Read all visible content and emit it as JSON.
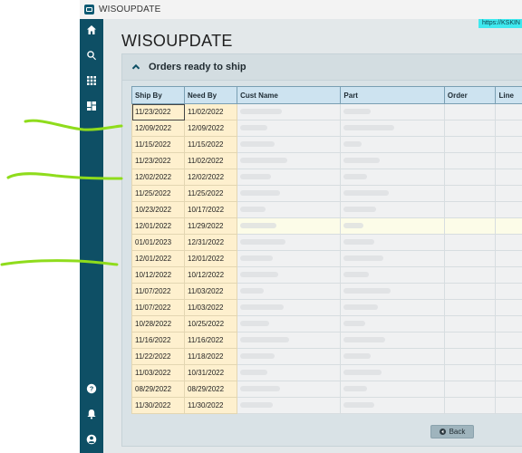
{
  "window": {
    "title": "WISOUPDATE"
  },
  "url_chip": "https://KSKIN",
  "page": {
    "title": "WISOUPDATE"
  },
  "panel": {
    "title": "Orders ready to ship"
  },
  "table": {
    "columns": [
      "Ship By",
      "Need By",
      "Cust Name",
      "Part",
      "Order",
      "Line"
    ],
    "rows": [
      {
        "ship_by": "11/23/2022",
        "need_by": "11/02/2022"
      },
      {
        "ship_by": "12/09/2022",
        "need_by": "12/09/2022"
      },
      {
        "ship_by": "11/15/2022",
        "need_by": "11/15/2022"
      },
      {
        "ship_by": "11/23/2022",
        "need_by": "11/02/2022"
      },
      {
        "ship_by": "12/02/2022",
        "need_by": "12/02/2022"
      },
      {
        "ship_by": "11/25/2022",
        "need_by": "11/25/2022"
      },
      {
        "ship_by": "10/23/2022",
        "need_by": "10/17/2022"
      },
      {
        "ship_by": "12/01/2022",
        "need_by": "11/29/2022"
      },
      {
        "ship_by": "01/01/2023",
        "need_by": "12/31/2022"
      },
      {
        "ship_by": "12/01/2022",
        "need_by": "12/01/2022"
      },
      {
        "ship_by": "10/12/2022",
        "need_by": "10/12/2022"
      },
      {
        "ship_by": "11/07/2022",
        "need_by": "11/03/2022"
      },
      {
        "ship_by": "11/07/2022",
        "need_by": "11/03/2022"
      },
      {
        "ship_by": "10/28/2022",
        "need_by": "10/25/2022"
      },
      {
        "ship_by": "11/16/2022",
        "need_by": "11/16/2022"
      },
      {
        "ship_by": "11/22/2022",
        "need_by": "11/18/2022"
      },
      {
        "ship_by": "11/03/2022",
        "need_by": "10/31/2022"
      },
      {
        "ship_by": "08/29/2022",
        "need_by": "08/29/2022"
      },
      {
        "ship_by": "11/30/2022",
        "need_by": "11/30/2022"
      }
    ]
  },
  "footer": {
    "back_label": "Back"
  },
  "sidebar": {
    "items": [
      {
        "icon": "home-icon"
      },
      {
        "icon": "search-icon"
      },
      {
        "icon": "apps-grid-icon"
      },
      {
        "icon": "dashboard-icon"
      },
      {
        "icon": "help-icon"
      },
      {
        "icon": "bell-icon"
      },
      {
        "icon": "user-icon"
      }
    ]
  },
  "colors": {
    "sidebar": "#0e4f65",
    "date_cell": "#fef0ce",
    "header_cell": "#cde3f0",
    "url_chip": "#3fe9ef",
    "annotation": "#8fdc1c"
  }
}
